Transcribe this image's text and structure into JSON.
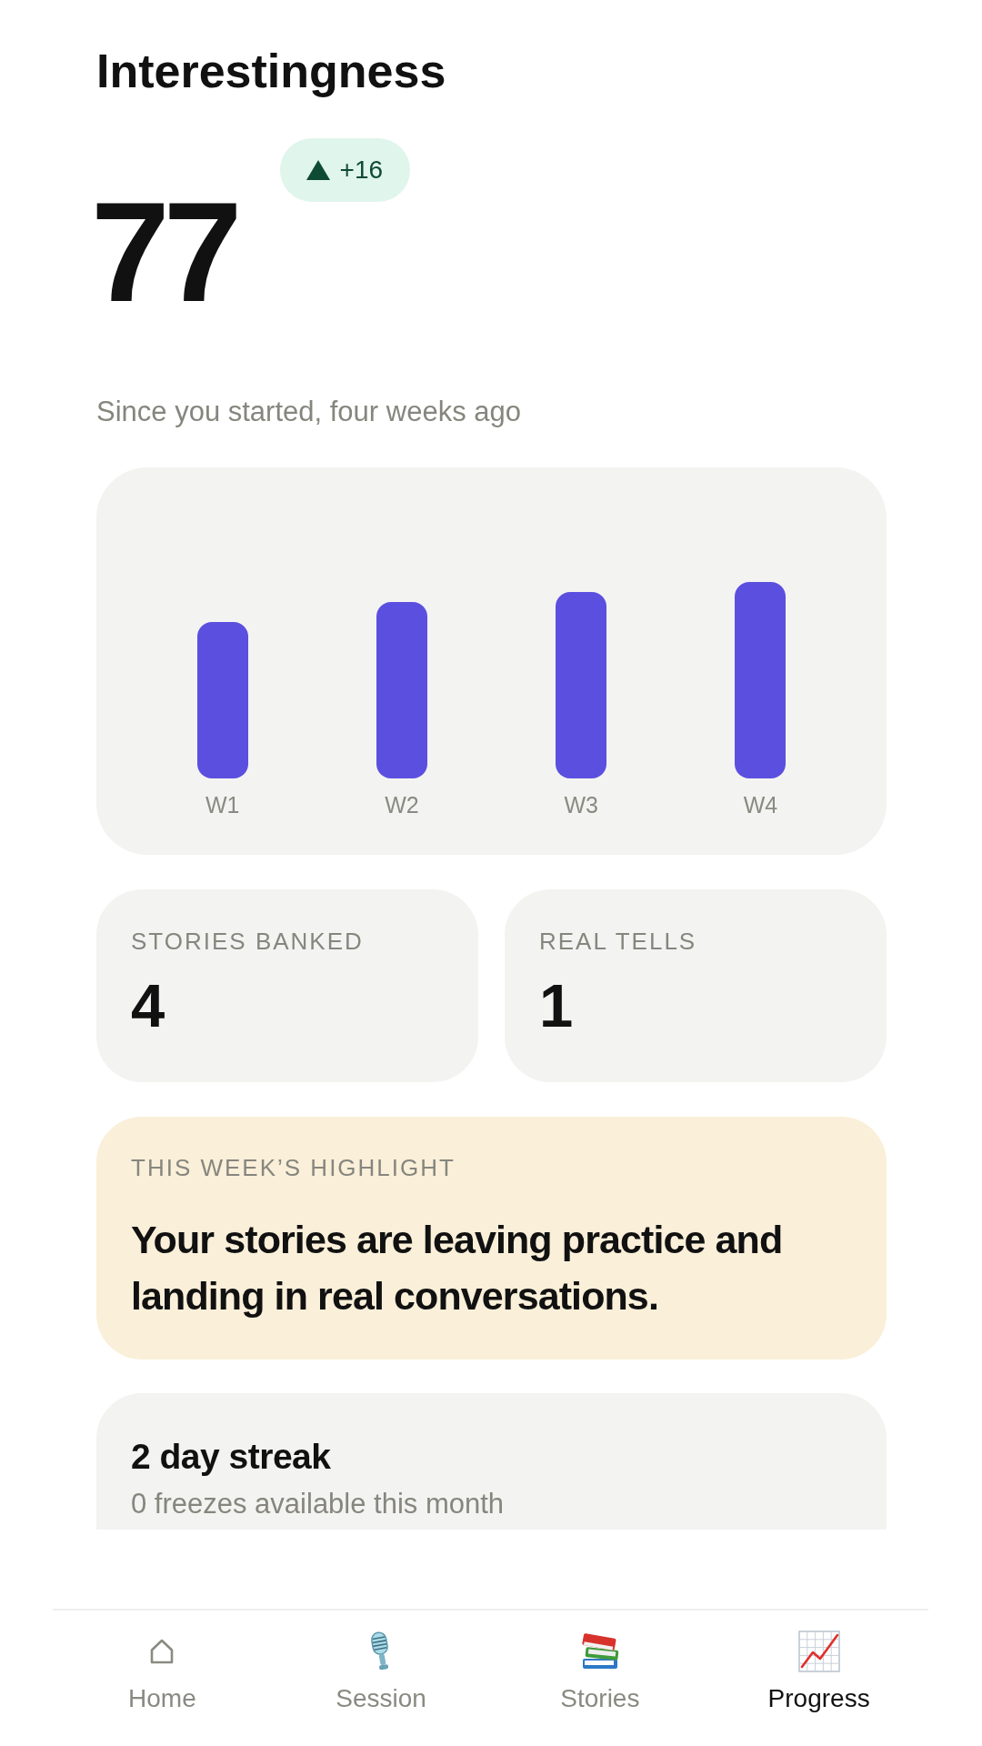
{
  "header": {
    "title": "Interestingness"
  },
  "score": {
    "value": "77",
    "change": {
      "kind": "increase",
      "text": "+16"
    },
    "caption": "Since you started, four weeks ago"
  },
  "chart": {
    "categories": [
      "W1",
      "W2",
      "W3",
      "W4"
    ]
  },
  "stats": [
    {
      "label": "STORIES BANKED",
      "value": "4"
    },
    {
      "label": "REAL TELLS",
      "value": "1"
    }
  ],
  "highlight": {
    "label": "THIS WEEK’S HIGHLIGHT",
    "text": "Your stories are leaving practice and landing in real conversations."
  },
  "streak": {
    "title": "2 day streak",
    "subtitle": "0 freezes available this month"
  },
  "nav": [
    {
      "label": "Home",
      "selected": false
    },
    {
      "label": "Session",
      "selected": false
    },
    {
      "label": "Stories",
      "selected": false
    },
    {
      "label": "Progress",
      "selected": true
    }
  ]
}
